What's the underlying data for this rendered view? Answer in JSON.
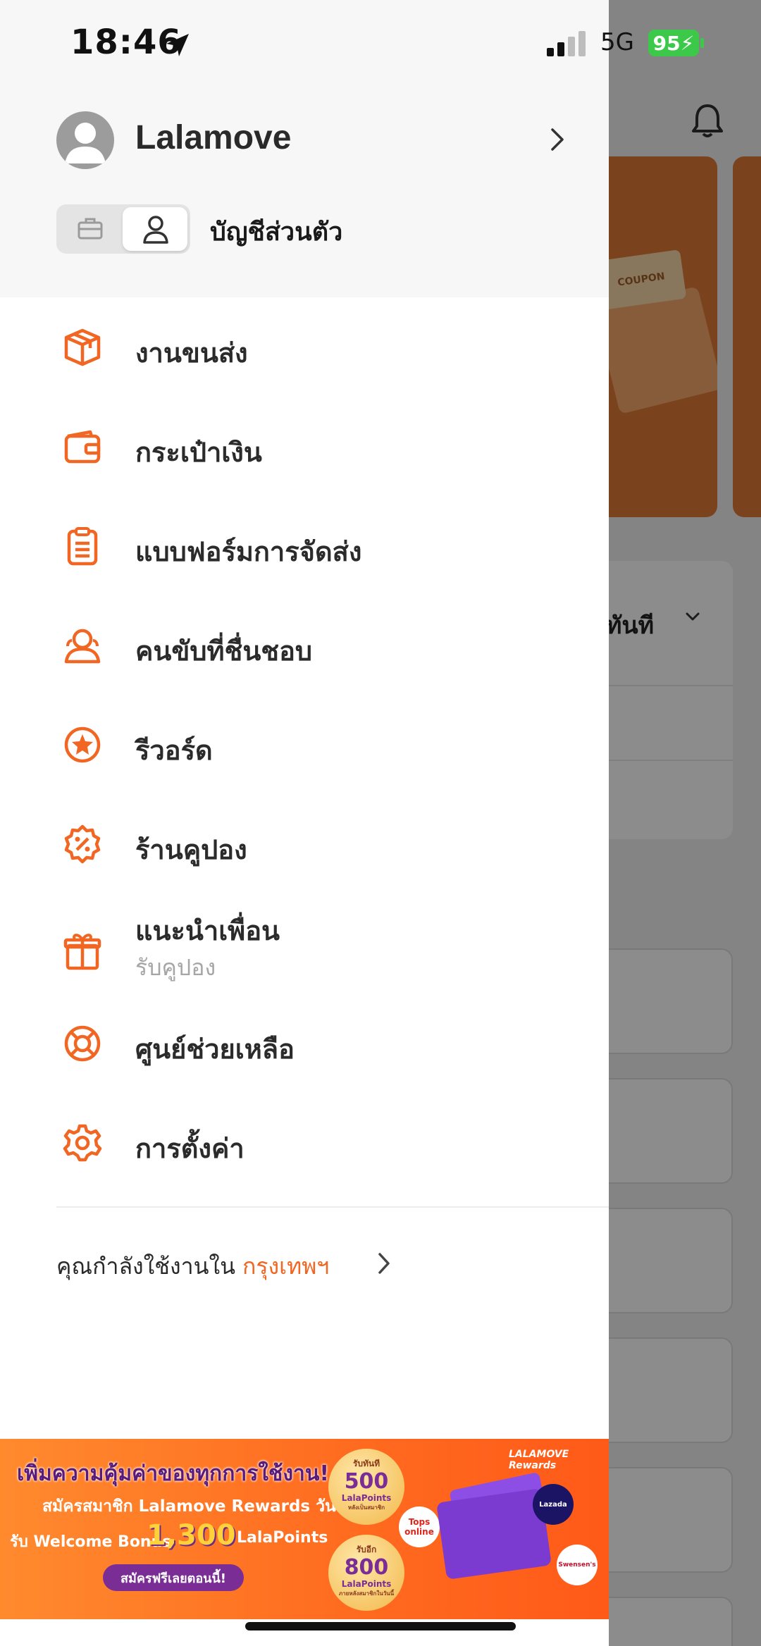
{
  "status_bar": {
    "time": "18:46",
    "network": "5G",
    "battery": "95"
  },
  "background": {
    "coupon_tag": "COUPON",
    "service_text": "ทันที"
  },
  "drawer": {
    "profile": {
      "name": "Lalamove"
    },
    "account": {
      "label": "บัญชีส่วนตัว"
    },
    "menu": [
      {
        "label": "งานขนส่ง",
        "icon": "package-icon"
      },
      {
        "label": "กระเป๋าเงิน",
        "icon": "wallet-icon"
      },
      {
        "label": "แบบฟอร์มการจัดส่ง",
        "icon": "clipboard-icon"
      },
      {
        "label": "คนขับที่ชื่นชอบ",
        "icon": "favorite-drivers-icon"
      },
      {
        "label": "รีวอร์ด",
        "icon": "rewards-star-icon"
      },
      {
        "label": "ร้านคูปอง",
        "icon": "coupon-badge-icon"
      },
      {
        "label": "แนะนำเพื่อน",
        "sublabel": "รับคูปอง",
        "icon": "gift-icon"
      },
      {
        "label": "ศูนย์ช่วยเหลือ",
        "icon": "lifebuoy-icon"
      },
      {
        "label": "การตั้งค่า",
        "icon": "gear-icon"
      }
    ],
    "city": {
      "prefix": "คุณกำลังใช้งานใน",
      "name": "กรุงเทพฯ"
    },
    "accent_color": "#F16622"
  },
  "banner": {
    "brand": "LALAMOVE Rewards",
    "title": "เพิ่มความคุ้มค่าของทุกการใช้งาน!",
    "line2": "สมัครสมาชิก Lalamove Rewards วันนี้",
    "line3": "รับ Welcome Bonus",
    "big_number": "1,300",
    "points_label": "LalaPoints",
    "cta": "สมัครฟรีเลยตอนนี้!",
    "coin1": {
      "top": "รับทันที",
      "value": "500",
      "unit": "LalaPoints",
      "note": "หลังเป็นสมาชิก"
    },
    "coin2": {
      "top": "รับอีก",
      "value": "800",
      "unit": "LalaPoints",
      "note": "ภายหลังสมาชิกในวันนี้"
    },
    "partner1": "Tops online",
    "partner2": "Lazada",
    "partner3": "Swensen's"
  }
}
